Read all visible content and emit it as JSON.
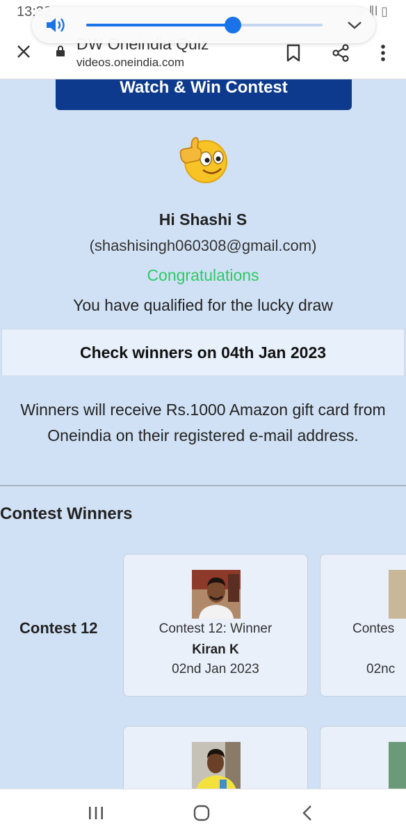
{
  "status_bar": {
    "time": "13:32",
    "indicators": "⊜ ∥l ▯"
  },
  "browser": {
    "title": "DW Oneindia Quiz",
    "url": "videos.oneindia.com",
    "icons": [
      "close-icon",
      "lock-icon",
      "bookmark-icon",
      "share-icon",
      "more-vert-icon"
    ]
  },
  "volume": {
    "level": 0.62,
    "accent_color": "#1a73e8",
    "icons": [
      "speaker-icon",
      "chevron-down-icon"
    ]
  },
  "page": {
    "contest_button": "Watch & Win Contest",
    "greeting": "Hi Shashi S",
    "email": "(shashisingh060308@gmail.com)",
    "congrats": "Congratulations",
    "qualified": "You have qualified for the lucky draw",
    "check_winners": "Check winners on 04th Jan 2023",
    "prize_line1": "Winners will receive Rs.1000 Amazon gift card from",
    "prize_line2": "Oneindia on their registered e-mail address."
  },
  "winners": {
    "section_title": "Contest Winners",
    "rows": [
      {
        "label": "Contest 12",
        "cards": [
          {
            "line1": "Contest 12: Winner",
            "name": "Kiran K",
            "date": "02nd Jan 2023"
          },
          {
            "line1": "Contes",
            "name": "",
            "date": "02nc"
          }
        ]
      }
    ]
  },
  "colors": {
    "page_bg": "#d1e1f5",
    "button_bg": "#0d3a8c",
    "congrats": "#2ec866"
  },
  "navbar": {
    "icons": [
      "recents-icon",
      "home-icon",
      "back-icon"
    ]
  }
}
